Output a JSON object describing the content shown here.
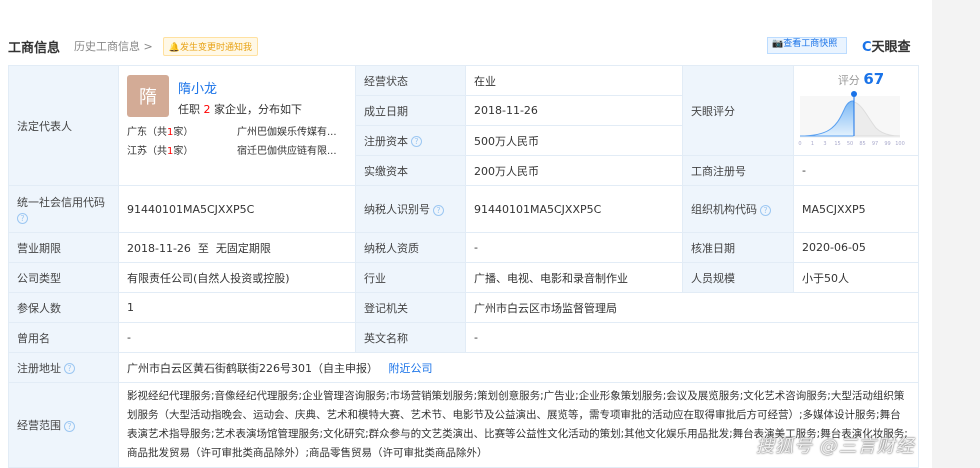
{
  "header": {
    "title": "工商信息",
    "history": "历史工商信息 >",
    "notify": "发生变更时通知我",
    "snapshot": "查看工商快照",
    "logo": "天眼查"
  },
  "legal": {
    "label": "法定代表人",
    "avatar_char": "隋",
    "name": "隋小龙",
    "pos_prefix": "任职 ",
    "pos_count": "2",
    "pos_suffix": " 家企业，分布如下",
    "regions": [
      {
        "region_a": "广东（共",
        "count": "1",
        "region_b": "家）",
        "company": "广州巴伽娱乐传媒有..."
      },
      {
        "region_a": "江苏（共",
        "count": "1",
        "region_b": "家）",
        "company": "宿迁巴伽供应链有限..."
      }
    ]
  },
  "rows1": [
    {
      "label": "经营状态",
      "value": "在业"
    },
    {
      "label": "成立日期",
      "value": "2018-11-26"
    },
    {
      "label": "注册资本",
      "value": "500万人民币"
    },
    {
      "label": "实缴资本",
      "value": "200万人民币"
    }
  ],
  "score": {
    "label": "天眼评分",
    "score_label": "评分",
    "value": "67",
    "ticks": [
      "0",
      "1",
      "3",
      "15",
      "50",
      "85",
      "97",
      "99",
      "100"
    ]
  },
  "reg_no": {
    "label": "工商注册号",
    "value": "-"
  },
  "credit": {
    "label": "统一社会信用代码",
    "value": "91440101MA5CJXXP5C",
    "tax_label": "纳税人识别号",
    "tax_value": "91440101MA5CJXXP5C",
    "org_label": "组织机构代码",
    "org_value": "MA5CJXXP5"
  },
  "term": {
    "label": "营业期限",
    "value": "2018-11-26  至  无固定期限",
    "q_label": "纳税人资质",
    "q_value": "-",
    "approve_label": "核准日期",
    "approve_value": "2020-06-05"
  },
  "type": {
    "label": "公司类型",
    "value": "有限责任公司(自然人投资或控股)",
    "ind_label": "行业",
    "ind_value": "广播、电视、电影和录音制作业",
    "size_label": "人员规模",
    "size_value": "小于50人"
  },
  "insured": {
    "label": "参保人数",
    "value": "1",
    "auth_label": "登记机关",
    "auth_value": "广州市白云区市场监督管理局"
  },
  "former": {
    "label": "曾用名",
    "value": "-",
    "en_label": "英文名称",
    "en_value": "-"
  },
  "address": {
    "label": "注册地址",
    "value": "广州市白云区黄石街鹤联街226号301（自主申报）",
    "nearby": "附近公司"
  },
  "scope": {
    "label": "经营范围",
    "value": "影视经纪代理服务;音像经纪代理服务;企业管理咨询服务;市场营销策划服务;策划创意服务;广告业;企业形象策划服务;会议及展览服务;文化艺术咨询服务;大型活动组织策划服务（大型活动指晚会、运动会、庆典、艺术和模特大赛、艺术节、电影节及公益演出、展览等，需专项审批的活动应在取得审批后方可经营）;多媒体设计服务;舞台表演艺术指导服务;艺术表演场馆管理服务;文化研究;群众参与的文艺类演出、比赛等公益性文化活动的策划;其他文化娱乐用品批发;舞台表演美工服务;舞台表演化妆服务;商品批发贸易（许可审批类商品除外）;商品零售贸易（许可审批类商品除外）"
  },
  "watermark": "搜狐号 @三言财经"
}
